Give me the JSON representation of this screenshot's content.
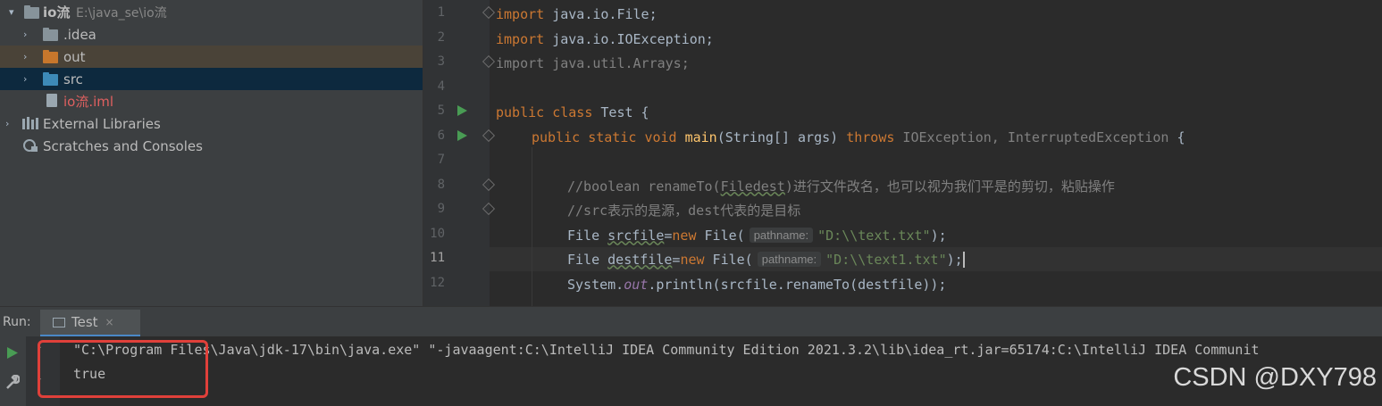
{
  "project_tree": {
    "root": {
      "name": "io流",
      "path": "E:\\java_se\\io流"
    },
    "items": [
      {
        "label": ".idea"
      },
      {
        "label": "out"
      },
      {
        "label": "src"
      },
      {
        "label": "io流.iml"
      },
      {
        "label": "External Libraries"
      },
      {
        "label": "Scratches and Consoles"
      }
    ]
  },
  "editor": {
    "line_numbers": [
      "1",
      "2",
      "3",
      "4",
      "5",
      "6",
      "7",
      "8",
      "9",
      "10",
      "11",
      "12"
    ],
    "current_line": "11",
    "lines": {
      "l1": {
        "kw": "import",
        "rest": " java.io.File;"
      },
      "l2": {
        "kw": "import",
        "rest": " java.io.IOException;"
      },
      "l3": {
        "kw": "import",
        "rest": " java.util.Arrays;"
      },
      "l5": {
        "kw1": "public",
        "kw2": "class",
        "rest": " Test {"
      },
      "l6": {
        "kw1": "public",
        "kw2": "static",
        "kw3": "void",
        "method": "main",
        "params": "(String[] args) ",
        "kw4": "throws",
        "ex": " IOException, InterruptedException",
        "brace": " {"
      },
      "l8": {
        "pre": "//boolean renameTo(",
        "ul": "Filedest",
        "post": ")进行文件改名，也可以视为我们平是的剪切，粘贴操作"
      },
      "l9": {
        "text": "//src表示的是源，dest代表的是目标"
      },
      "l10": {
        "a": "File ",
        "var": "srcfile",
        "eq": "=",
        "kw": "new",
        "b": " File(",
        "hint": "pathname:",
        "str": "\"D:\\\\text.txt\"",
        "end": ");"
      },
      "l11": {
        "a": "File ",
        "var": "destfile",
        "eq": "=",
        "kw": "new",
        "b": " File(",
        "hint": "pathname:",
        "str": "\"D:\\\\text1.txt\"",
        "end": ");"
      },
      "l12": {
        "a": "System.",
        "field": "out",
        "b": ".println(srcfile.renameTo(destfile));"
      }
    }
  },
  "run_panel": {
    "label": "Run:",
    "tab": "Test",
    "tab_close": "×",
    "console": [
      "\"C:\\Program Files\\Java\\jdk-17\\bin\\java.exe\" \"-javaagent:C:\\IntelliJ IDEA Community Edition 2021.3.2\\lib\\idea_rt.jar=65174:C:\\IntelliJ IDEA Communit",
      "true"
    ]
  },
  "watermark": "CSDN @DXY798",
  "colors": {
    "highlight_box": "#e0403a",
    "run_icon": "#499c54"
  }
}
